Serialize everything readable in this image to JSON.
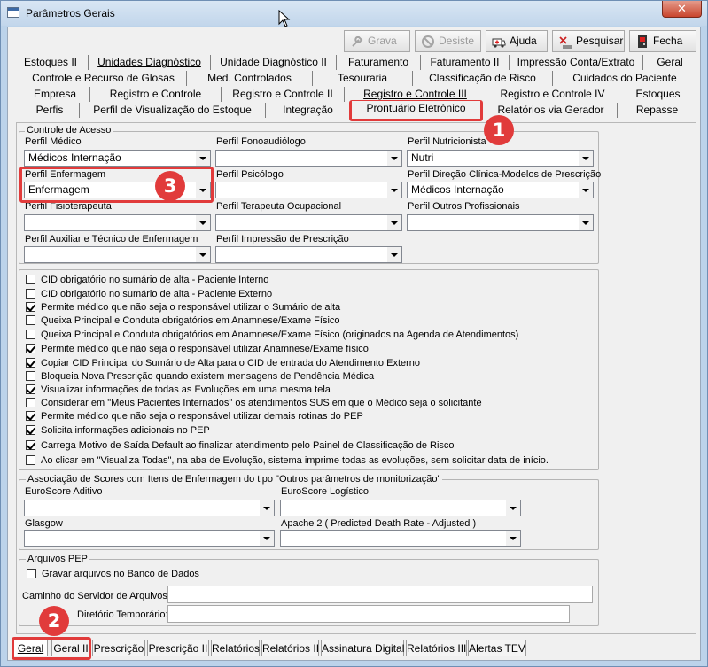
{
  "window": {
    "title": "Parâmetros Gerais"
  },
  "toolbar": {
    "grava": "Grava",
    "desiste": "Desiste",
    "ajuda": "Ajuda",
    "pesquisar": "Pesquisar",
    "fecha": "Fecha"
  },
  "tabs": {
    "row1": [
      "Estoques II",
      "Unidades Diagnóstico",
      "Unidade Diagnóstico II",
      "Faturamento",
      "Faturamento II",
      "Impressão Conta/Extrato",
      "Geral"
    ],
    "row2": [
      "Controle e Recurso de Glosas",
      "Med. Controlados",
      "Tesouraria",
      "Classificação de Risco",
      "Cuidados do Paciente"
    ],
    "row3": [
      "Empresa",
      "Registro e Controle",
      "Registro e Controle II",
      "Registro e Controle III",
      "Registro e Controle IV",
      "Estoques"
    ],
    "row4": [
      "Perfis",
      "Perfil de Visualização do Estoque",
      "Integração",
      "Prontuário Eletrônico",
      "Relatórios via Gerador",
      "Repasse"
    ]
  },
  "controle": {
    "legend": "Controle de Acesso",
    "perfil_medico": {
      "label": "Perfil Médico",
      "value": "Médicos Internação"
    },
    "perfil_fono": {
      "label": "Perfil Fonoaudiólogo",
      "value": ""
    },
    "perfil_nutri": {
      "label": "Perfil Nutricionista",
      "value": "Nutri"
    },
    "perfil_enf": {
      "label": "Perfil Enfermagem",
      "value": "Enfermagem"
    },
    "perfil_psico": {
      "label": "Perfil Psicólogo",
      "value": ""
    },
    "perfil_direcao": {
      "label": "Perfil Direção Clínica-Modelos de Prescrição",
      "value": "Médicos Internação"
    },
    "perfil_fisio": {
      "label": "Perfil Fisioterapeuta",
      "value": ""
    },
    "perfil_to": {
      "label": "Perfil Terapeuta Ocupacional",
      "value": ""
    },
    "perfil_outros": {
      "label": "Perfil Outros Profissionais",
      "value": ""
    },
    "perfil_aux": {
      "label": "Perfil Auxiliar e Técnico de Enfermagem",
      "value": ""
    },
    "perfil_impressao": {
      "label": "Perfil Impressão de Prescrição",
      "value": ""
    }
  },
  "checks": [
    {
      "label": "CID obrigatório no sumário de alta - Paciente Interno",
      "checked": false
    },
    {
      "label": "CID obrigatório no sumário de alta - Paciente Externo",
      "checked": false
    },
    {
      "label": "Permite médico que não seja o responsável utilizar o Sumário de alta",
      "checked": true
    },
    {
      "label": "Queixa Principal e Conduta obrigatórios em Anamnese/Exame Físico",
      "checked": false
    },
    {
      "label": "Queixa Principal e Conduta obrigatórios em Anamnese/Exame Físico (originados na Agenda de Atendimentos)",
      "checked": false
    },
    {
      "label": "Permite médico que não seja o responsável utilizar Anamnese/Exame físico",
      "checked": true
    },
    {
      "label": "Copiar CID Principal do Sumário de Alta para o CID de entrada do Atendimento Externo",
      "checked": true
    },
    {
      "label": "Bloqueia Nova Prescrição quando existem mensagens de Pendência Médica",
      "checked": false
    },
    {
      "label": "Visualizar informações de todas as Evoluções em uma mesma tela",
      "checked": true
    },
    {
      "label": "Considerar em \"Meus Pacientes Internados\" os atendimentos SUS em que o Médico seja o solicitante",
      "checked": false
    },
    {
      "label": "Permite médico que não seja o responsável utilizar demais rotinas do PEP",
      "checked": true
    },
    {
      "label": "Solicita informações adicionais no PEP",
      "checked": true
    },
    {
      "label": "Carrega Motivo de Saída Default ao finalizar atendimento pelo Painel de Classificação de Risco",
      "checked": true
    },
    {
      "label": "Ao clicar em \"Visualiza Todas\", na aba de Evolução, sistema imprime todas as evoluções, sem solicitar data de início.",
      "checked": false
    }
  ],
  "scores": {
    "legend": "Associação de Scores com Itens de Enfermagem do tipo \"Outros parâmetros de monitorização\"",
    "euroscore_aditivo": "EuroScore Aditivo",
    "euroscore_logistico": "EuroScore Logístico",
    "glasgow": "Glasgow",
    "apache": "Apache 2 ( Predicted Death Rate - Adjusted )"
  },
  "arquivos": {
    "legend": "Arquivos PEP",
    "gravar": "Gravar arquivos no Banco de Dados",
    "caminho": "Caminho do Servidor de Arquivos:",
    "diretorio": "Diretório Temporário:"
  },
  "bottom_tabs": [
    "Geral",
    "Geral II",
    "Prescrição",
    "Prescrição II",
    "Relatórios",
    "Relatórios II",
    "Assinatura Digital",
    "Relatórios III",
    "Alertas TEV"
  ],
  "badges": {
    "one": "1",
    "two": "2",
    "three": "3"
  },
  "colors": {
    "highlight": "#e13b3b"
  }
}
